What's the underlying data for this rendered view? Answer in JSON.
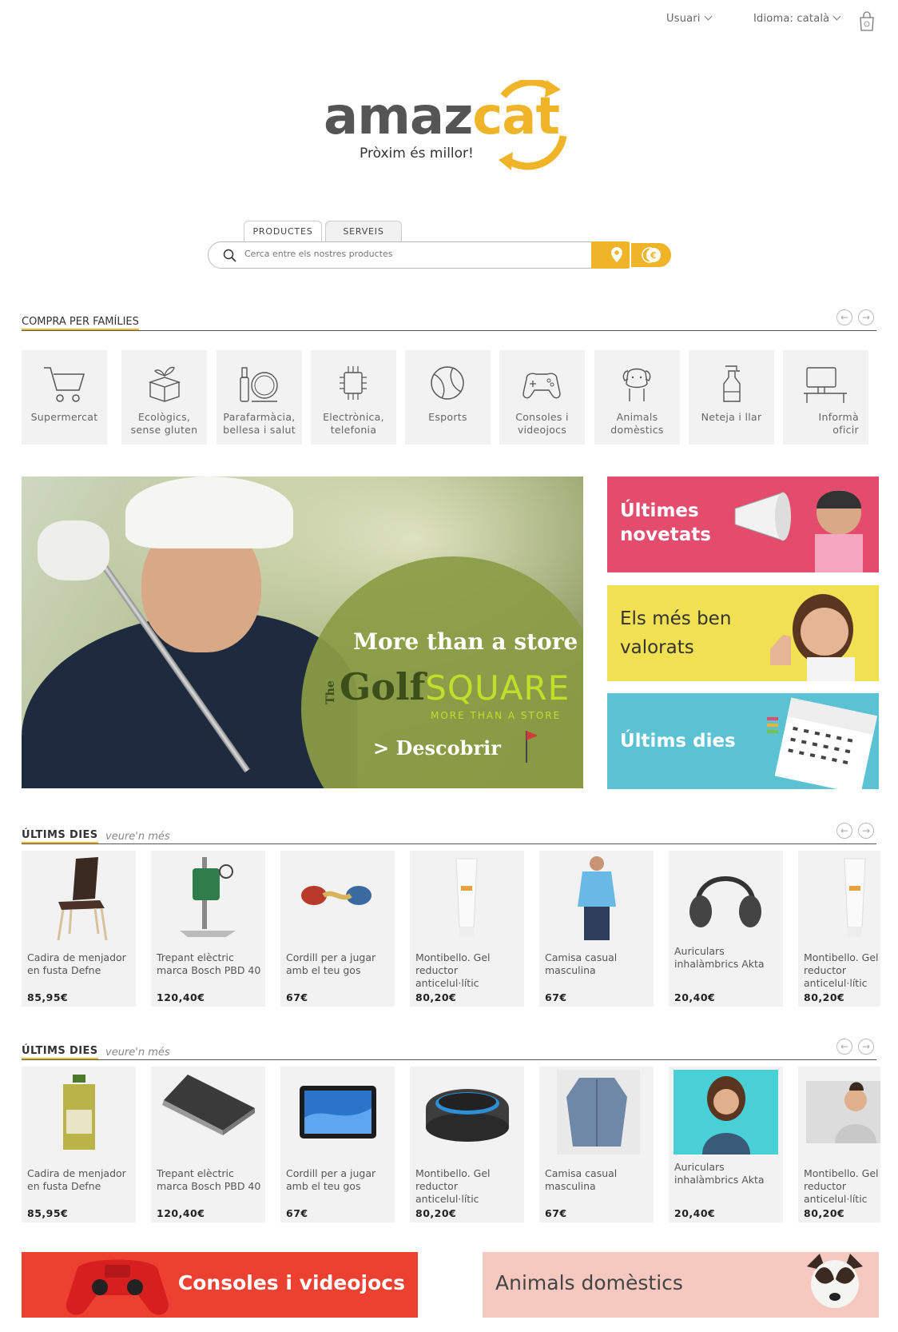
{
  "topbar": {
    "user_label": "Usuari",
    "language_label": "Idioma: català"
  },
  "logo": {
    "word_a": "amaz",
    "word_b": "cat",
    "tagline": "Pròxim és millor!"
  },
  "search": {
    "tabs": [
      "PRODUCTES",
      "SERVEIS"
    ],
    "placeholder": "Cerca entre els nostres productes"
  },
  "families": {
    "title": "COMPRA PER FAMÍLIES",
    "items": [
      {
        "line1": "Supermercat",
        "line2": "",
        "icon": "shopping-cart-icon"
      },
      {
        "line1": "Ecològics,",
        "line2": "sense gluten",
        "icon": "eco-box-icon"
      },
      {
        "line1": "Parafarmàcia,",
        "line2": "bellesa i salut",
        "icon": "cosmetics-mirror-icon"
      },
      {
        "line1": "Electrònica,",
        "line2": "telefonia",
        "icon": "chip-icon"
      },
      {
        "line1": "Esports",
        "line2": "",
        "icon": "ball-icon"
      },
      {
        "line1": "Consoles i",
        "line2": "videojocs",
        "icon": "gamepad-icon"
      },
      {
        "line1": "Animals",
        "line2": "domèstics",
        "icon": "dog-icon"
      },
      {
        "line1": "Neteja i llar",
        "line2": "",
        "icon": "spray-bottle-icon"
      },
      {
        "line1": "Informà",
        "line2": "oficir",
        "icon": "computer-icon"
      }
    ]
  },
  "hero": {
    "headline": "More than a store",
    "brand_the": "The",
    "brand_golf": "Golf",
    "brand_square": "SQUARE",
    "brand_tagline": "MORE THAN A STORE",
    "cta": "> Descobrir"
  },
  "side_banners": [
    {
      "line1": "Últimes",
      "line2": "novetats"
    },
    {
      "line1": "Els més ben",
      "line2": "valorats"
    },
    {
      "line1": "Últims dies",
      "line2": ""
    }
  ],
  "section1": {
    "title": "ÚLTIMS DIES",
    "more": "veure'n més",
    "products": [
      {
        "name": "Cadira de menjador en fusta Defne",
        "price": "85,95€",
        "image": "chair"
      },
      {
        "name": "Trepant elèctric marca Bosch PBD 40",
        "price": "120,40€",
        "image": "drill"
      },
      {
        "name": "Cordill per a jugar amb el teu gos",
        "price": "67€",
        "image": "rope-toy"
      },
      {
        "name": "Montibello. Gel reductor anticelul·lític",
        "price": "80,20€",
        "image": "cream-tube"
      },
      {
        "name": "Camisa casual masculina",
        "price": "67€",
        "image": "shirt-man"
      },
      {
        "name": "Auriculars inhalàmbrics Akta",
        "price": "20,40€",
        "image": "headphones"
      },
      {
        "name": "Montibello. Gel reductor anticelul·lític",
        "price": "80,20€",
        "image": "cream-tube"
      }
    ]
  },
  "section2": {
    "title": "ÚLTIMS DIES",
    "more": "veure'n més",
    "products": [
      {
        "name": "Cadira de menjador en fusta Defne",
        "price": "85,95€",
        "image": "oil-bottle"
      },
      {
        "name": "Trepant elèctric marca Bosch PBD 40",
        "price": "120,40€",
        "image": "laptop"
      },
      {
        "name": "Cordill per a jugar amb el teu gos",
        "price": "67€",
        "image": "tablet"
      },
      {
        "name": "Montibello. Gel reductor anticelul·lític",
        "price": "80,20€",
        "image": "smart-speaker"
      },
      {
        "name": "Camisa casual masculina",
        "price": "67€",
        "image": "cardigan"
      },
      {
        "name": "Auriculars inhalàmbrics Akta",
        "price": "20,40€",
        "image": "woman-photo"
      },
      {
        "name": "Montibello. Gel reductor anticelul·lític",
        "price": "80,20€",
        "image": "woman-sweater"
      }
    ]
  },
  "bottom_banners": {
    "left": "Consoles i videojocs",
    "right": "Animals domèstics"
  },
  "colors": {
    "accent": "#f0b429",
    "pink": "#e44c6e",
    "yellow": "#f1e052",
    "blue": "#5bc2d4",
    "red": "#ec4031",
    "salmon": "#f6c9c0"
  }
}
